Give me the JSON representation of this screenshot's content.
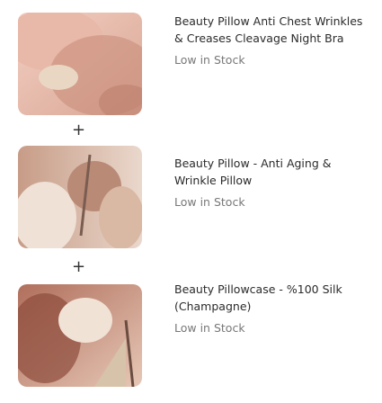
{
  "products": [
    {
      "title": "Beauty Pillow Anti Chest Wrinkles & Creases Cleavage Night Bra",
      "stock": "Low in Stock"
    },
    {
      "title": "Beauty Pillow - Anti Aging & Wrinkle Pillow",
      "stock": "Low in Stock"
    },
    {
      "title": "Beauty Pillowcase - %100 Silk (Champagne)",
      "stock": "Low in Stock"
    }
  ],
  "separator_symbol": "+",
  "icons": [
    "plus-icon"
  ]
}
